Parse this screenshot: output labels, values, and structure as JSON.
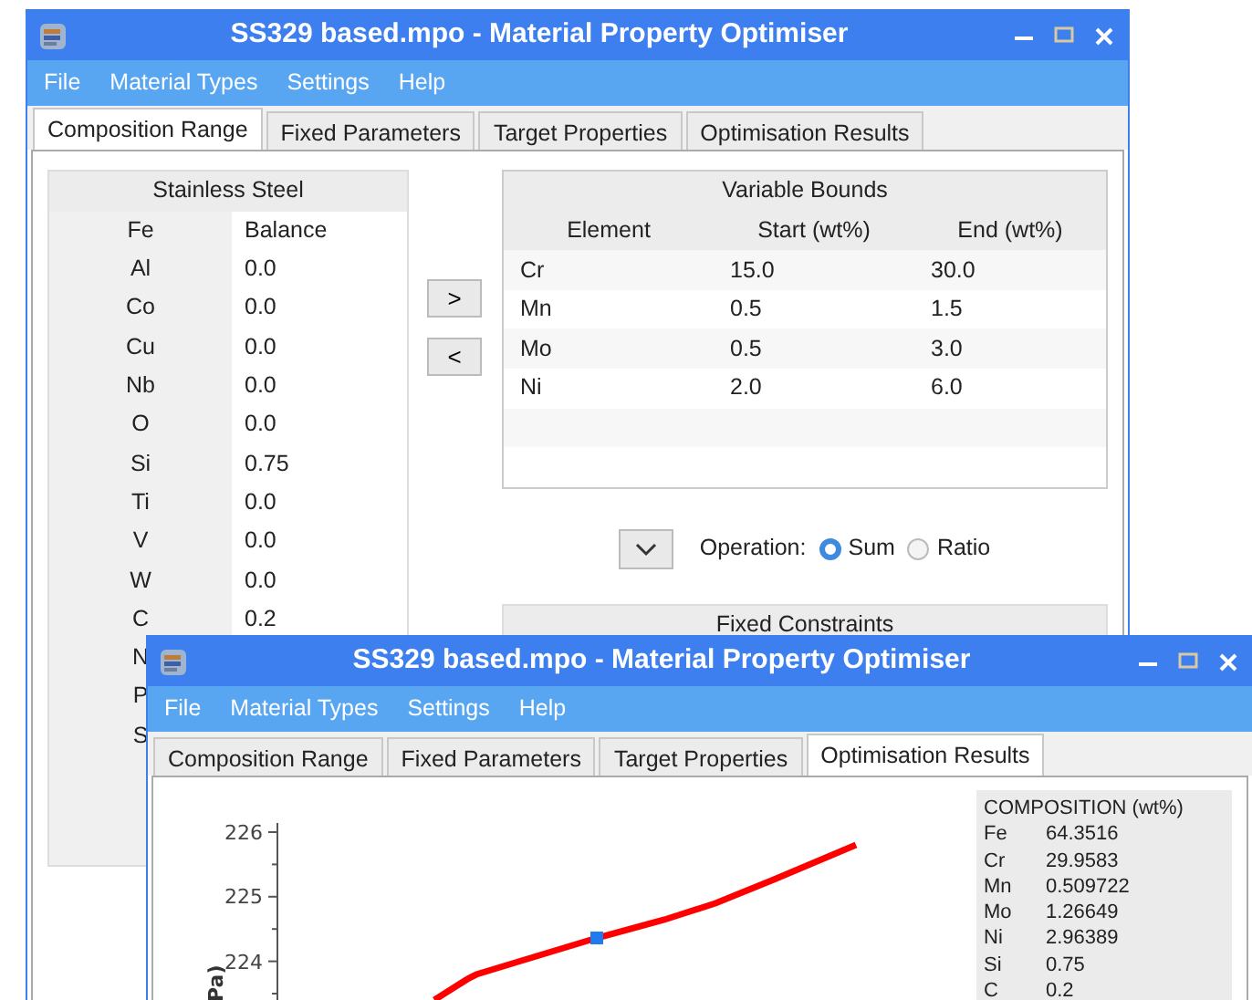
{
  "back_window": {
    "title": "SS329 based.mpo - Material Property Optimiser",
    "menu": [
      "File",
      "Material Types",
      "Settings",
      "Help"
    ],
    "tabs": [
      {
        "label": "Composition Range",
        "selected": true
      },
      {
        "label": "Fixed Parameters",
        "selected": false
      },
      {
        "label": "Target Properties",
        "selected": false
      },
      {
        "label": "Optimisation Results",
        "selected": false
      }
    ],
    "base_table": {
      "title": "Stainless Steel",
      "rows": [
        {
          "element": "Fe",
          "value": "Balance"
        },
        {
          "element": "Al",
          "value": "0.0"
        },
        {
          "element": "Co",
          "value": "0.0"
        },
        {
          "element": "Cu",
          "value": "0.0"
        },
        {
          "element": "Nb",
          "value": "0.0"
        },
        {
          "element": "O",
          "value": "0.0"
        },
        {
          "element": "Si",
          "value": "0.75"
        },
        {
          "element": "Ti",
          "value": "0.0"
        },
        {
          "element": "V",
          "value": "0.0"
        },
        {
          "element": "W",
          "value": "0.0"
        },
        {
          "element": "C",
          "value": "0.2"
        },
        {
          "element": "N"
        },
        {
          "element": "P"
        },
        {
          "element": "S"
        }
      ]
    },
    "move_buttons": [
      ">",
      "<"
    ],
    "variable_bounds": {
      "title": "Variable Bounds",
      "columns": [
        "Element",
        "Start (wt%)",
        "End (wt%)"
      ],
      "rows": [
        [
          "Cr",
          "15.0",
          "30.0"
        ],
        [
          "Mn",
          "0.5",
          "1.5"
        ],
        [
          "Mo",
          "0.5",
          "3.0"
        ],
        [
          "Ni",
          "2.0",
          "6.0"
        ]
      ]
    },
    "operation": {
      "label": "Operation:",
      "options": [
        {
          "label": "Sum",
          "selected": true
        },
        {
          "label": "Ratio",
          "selected": false
        }
      ]
    },
    "fixed_constraints": {
      "title": "Fixed Constraints"
    }
  },
  "front_window": {
    "title": "SS329 based.mpo - Material Property Optimiser",
    "menu": [
      "File",
      "Material Types",
      "Settings",
      "Help"
    ],
    "tabs": [
      {
        "label": "Composition Range",
        "selected": false
      },
      {
        "label": "Fixed Parameters",
        "selected": false
      },
      {
        "label": "Target Properties",
        "selected": false
      },
      {
        "label": "Optimisation Results",
        "selected": true
      }
    ],
    "chart": {
      "y_tick_labels": [
        "226",
        "225",
        "224"
      ],
      "ylabel": "Pa)"
    },
    "composition": {
      "title": "COMPOSITION (wt%)",
      "rows": [
        {
          "element": "Fe",
          "value": "64.3516"
        },
        {
          "element": "Cr",
          "value": "29.9583"
        },
        {
          "element": "Mn",
          "value": "0.509722"
        },
        {
          "element": "Mo",
          "value": "1.26649"
        },
        {
          "element": "Ni",
          "value": "2.96389"
        },
        {
          "element": "Si",
          "value": "0.75"
        },
        {
          "element": "C",
          "value": "0.2"
        }
      ]
    }
  }
}
